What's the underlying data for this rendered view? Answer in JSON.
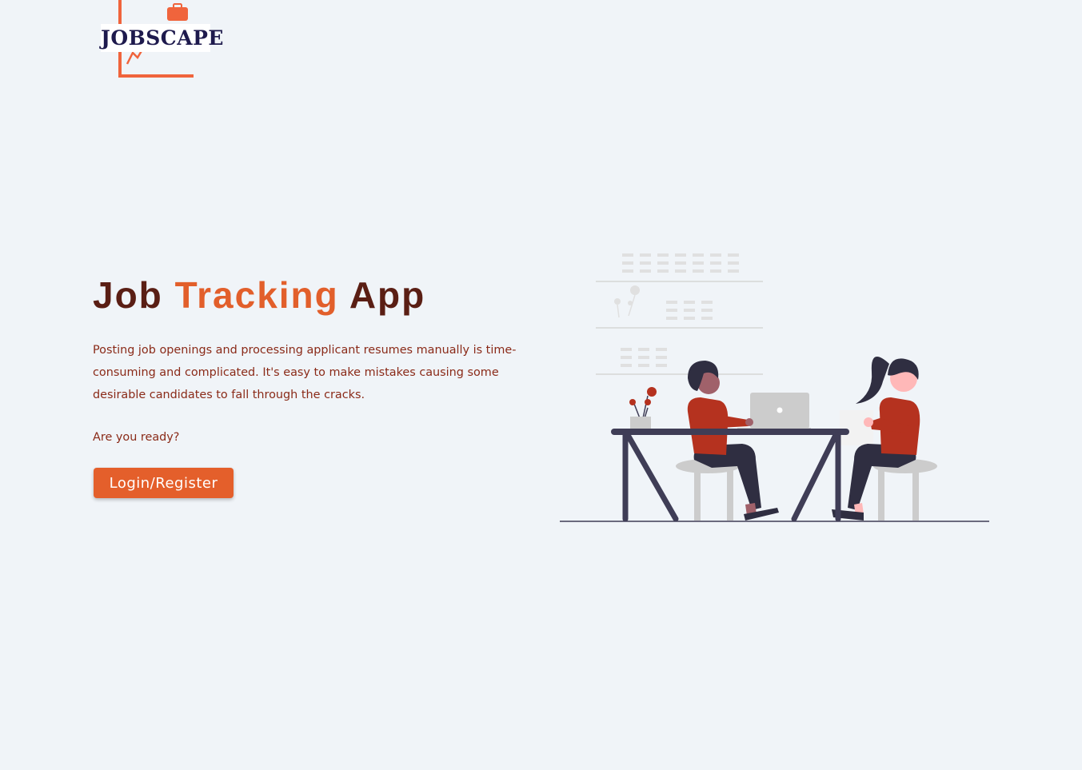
{
  "logo": {
    "text": "JOBSCAPE",
    "accent_color": "#f0643c",
    "text_color": "#1e1a4d"
  },
  "hero": {
    "title_part1": "Job ",
    "title_accent": "Tracking",
    "title_part2": " App",
    "description": "Posting job openings and processing applicant resumes manually is time-consuming and complicated. It's easy to make mistakes causing some desirable candidates to fall through the cracks.",
    "prompt": "Are you ready?",
    "cta_label": "Login/Register"
  },
  "illustration": {
    "icon": "office-workers-illustration",
    "colors": {
      "shirt": "#b5321f",
      "dark": "#3f3d56",
      "skin": "#a0616a",
      "gray": "#cccccc"
    }
  },
  "colors": {
    "background": "#f0f4f8",
    "brand_orange": "#e45f2b",
    "title_dark": "#5a1e14",
    "body_text": "#8a2a18"
  }
}
